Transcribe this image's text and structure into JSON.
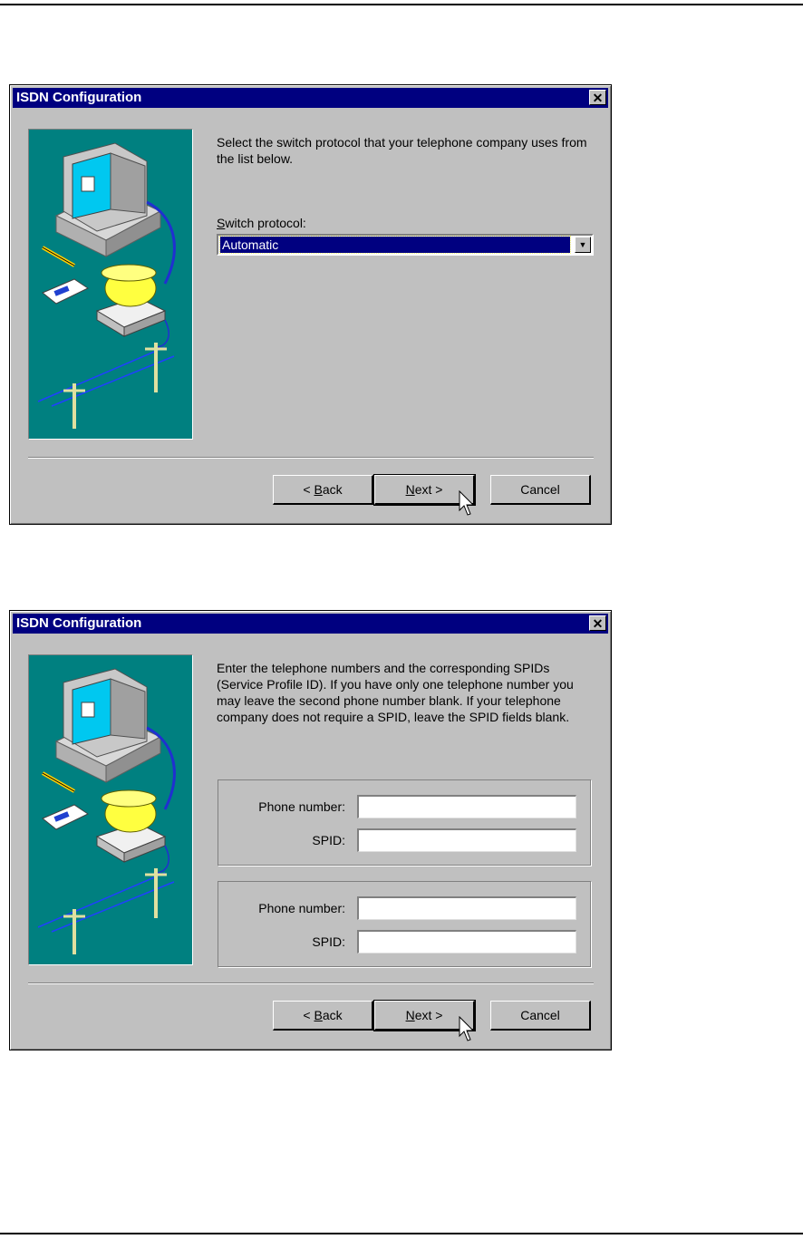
{
  "dialog1": {
    "title": "ISDN Configuration",
    "close": "✕",
    "instructions": "Select the switch protocol that your telephone company uses from the list below.",
    "switch_label_accel": "S",
    "switch_label_rest": "witch protocol:",
    "switch_value": "Automatic",
    "back_pre": "< ",
    "back_accel": "B",
    "back_rest": "ack",
    "next_accel": "N",
    "next_rest": "ext >",
    "cancel": "Cancel"
  },
  "dialog2": {
    "title": "ISDN Configuration",
    "close": "✕",
    "instructions": "Enter the telephone numbers and the corresponding SPIDs (Service Profile ID).  If you have only one telephone number you may leave the second phone number blank.  If your telephone company does not require a SPID, leave the SPID fields blank.",
    "group1": {
      "phone_label": "Phone number:",
      "phone_value": "",
      "spid_label": "SPID:",
      "spid_value": ""
    },
    "group2": {
      "phone_label": "Phone number:",
      "phone_value": "",
      "spid_label": "SPID:",
      "spid_value": ""
    },
    "back_pre": "< ",
    "back_accel": "B",
    "back_rest": "ack",
    "next_accel": "N",
    "next_rest": "ext >",
    "cancel": "Cancel"
  },
  "icons": [
    "close-icon",
    "dropdown-arrow-icon",
    "computer-illustration",
    "mouse-pointer-icon"
  ]
}
